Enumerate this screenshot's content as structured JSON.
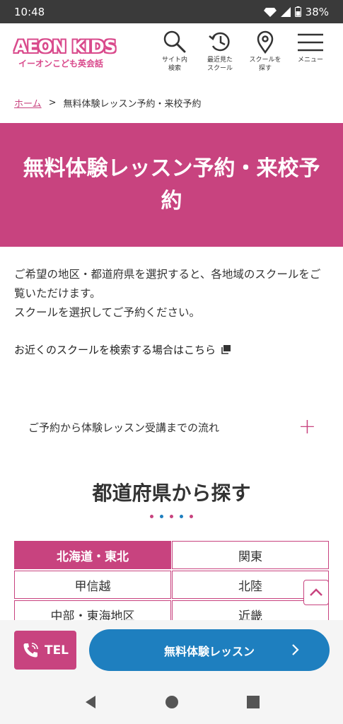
{
  "status_bar": {
    "time": "10:48",
    "battery": "38%"
  },
  "header": {
    "logo_main": "AEON KIDS",
    "logo_sub": "イーオンこども英会話",
    "nav": [
      {
        "label": "サイト内\n検索",
        "icon": "search-icon"
      },
      {
        "label": "最近見た\nスクール",
        "icon": "history-icon"
      },
      {
        "label": "スクールを\n探す",
        "icon": "location-pin-icon"
      },
      {
        "label": "メニュー",
        "icon": "hamburger-menu-icon"
      }
    ]
  },
  "breadcrumb": {
    "home": "ホーム",
    "separator": ">",
    "current": "無料体験レッスン予約・来校予約"
  },
  "hero": {
    "title": "無料体験レッスン予約・来校予約"
  },
  "intro": {
    "line1": "ご希望の地区・都道府県を選択すると、各地域のスクールをご覧いただけます。",
    "line2": "スクールを選択してご予約ください。"
  },
  "nearby_link": "お近くのスクールを検索する場合はこちら",
  "flow": {
    "label": "ご予約から体験レッスン受講までの流れ",
    "toggle": "+"
  },
  "section": {
    "title": "都道府県から探す"
  },
  "dot_colors": [
    "#c8437f",
    "#1e7fbf",
    "#c8437f",
    "#1e7fbf",
    "#c8437f"
  ],
  "prefectures": [
    {
      "label": "北海道・東北",
      "active": true
    },
    {
      "label": "関東",
      "active": false
    },
    {
      "label": "甲信越",
      "active": false
    },
    {
      "label": "北陸",
      "active": false
    },
    {
      "label": "中部・東海地区",
      "active": false
    },
    {
      "label": "近畿",
      "active": false
    }
  ],
  "bottom_bar": {
    "tel_label": "TEL",
    "trial_label": "無料体験レッスン"
  },
  "colors": {
    "brand_pink": "#c8437f",
    "brand_blue": "#1e7fbf"
  }
}
